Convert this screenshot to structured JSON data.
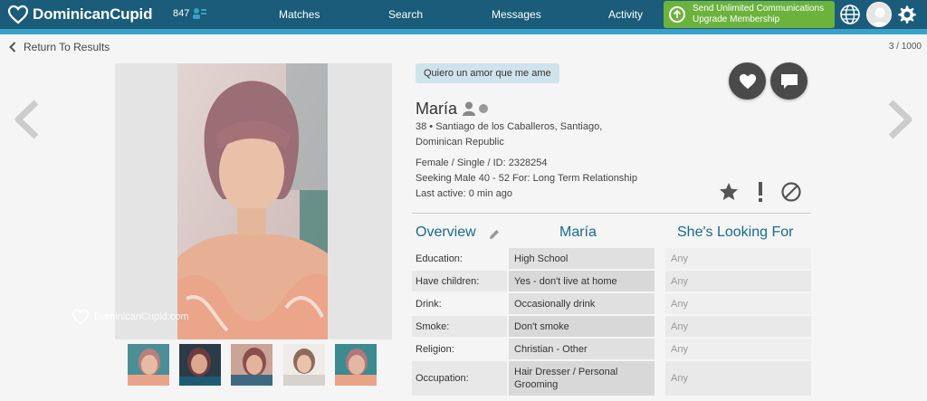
{
  "brand": {
    "name": "DominicanCupid"
  },
  "header": {
    "notification_count": "847",
    "nav": [
      "Matches",
      "Search",
      "Messages",
      "Activity"
    ],
    "upgrade_line1": "Send Unlimited Communications",
    "upgrade_line2": "Upgrade Membership"
  },
  "subbar": {
    "back_label": "Return To Results",
    "counter": "3 / 1000"
  },
  "photo": {
    "watermark": "DominicanCupid.com"
  },
  "profile": {
    "tagline": "Quiero un amor que me ame",
    "name": "María",
    "location_line1": "38 • Santiago de los Caballeros, Santiago,",
    "location_line2": "Dominican Republic",
    "details": "Female / Single / ID: 2328254",
    "seeking": "Seeking Male 40 - 52 For: Long Term Relationship",
    "last_active": "Last active: 0 min ago"
  },
  "table": {
    "headers": {
      "overview": "Overview",
      "name": "María",
      "looking": "She's Looking For"
    },
    "rows": [
      {
        "label": "Education:",
        "value": "High School",
        "looking": "Any"
      },
      {
        "label": "Have children:",
        "value": "Yes - don't live at home",
        "looking": "Any"
      },
      {
        "label": "Drink:",
        "value": "Occasionally drink",
        "looking": "Any"
      },
      {
        "label": "Smoke:",
        "value": "Don't smoke",
        "looking": "Any"
      },
      {
        "label": "Religion:",
        "value": "Christian - Other",
        "looking": "Any"
      },
      {
        "label": "Occupation:",
        "value": "Hair Dresser / Personal Grooming",
        "looking": "Any"
      }
    ]
  },
  "colors": {
    "nav_bg": "#1a5c7a",
    "accent": "#3aa0c8",
    "upgrade": "#6cb33e",
    "heading": "#1a6a8c"
  }
}
